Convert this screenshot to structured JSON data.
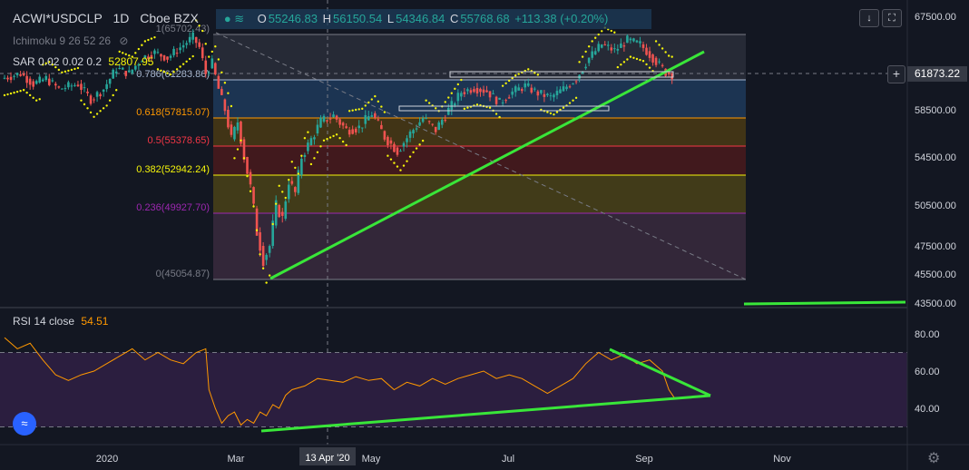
{
  "header": {
    "symbol": "ACWI*USDCLP",
    "interval": "1D",
    "exchange": "Cboe BZX",
    "open_label": "O",
    "open": "55246.83",
    "high_label": "H",
    "high": "56150.54",
    "low_label": "L",
    "low": "54346.84",
    "close_label": "C",
    "close": "55768.68",
    "change": "+113.38 (+0.20%)"
  },
  "indicators": {
    "ichimoku": "Ichimoku 9 26 52 26",
    "sar_label": "SAR 0.02 0.02 0.2",
    "sar_value": "52807.95",
    "rsi_label": "RSI 14 close",
    "rsi_value": "54.51"
  },
  "current_price": "61873.22",
  "colors": {
    "background": "#131722",
    "up": "#26a69a",
    "down": "#ef5350",
    "trendline": "#39e639",
    "sar": "#f5f50a",
    "rsi": "#ff9800",
    "rsi_band": "#2b1e3f"
  },
  "icons": [
    "eye-off-icon",
    "arrow-down-icon",
    "fullscreen-icon",
    "plus-icon",
    "gear-icon",
    "tradingview-logo-icon"
  ],
  "chart_data": {
    "type": "candlestick",
    "price_axis": {
      "ticks": [
        "67500.00",
        "58500.00",
        "54500.00",
        "50500.00",
        "47500.00",
        "45500.00",
        "43500.00"
      ],
      "tick_values": [
        67500,
        58500,
        54500,
        50500,
        47500,
        45500,
        43500
      ],
      "range": [
        43500,
        67500
      ]
    },
    "time_axis": {
      "ticks": [
        "2020",
        "Mar",
        "May",
        "Jul",
        "Sep",
        "Nov"
      ],
      "crosshair_label": "13 Apr '20"
    },
    "fib_levels": [
      {
        "label": "1(65702.43)",
        "ratio": 1,
        "value": 65702.43,
        "color": "#787b86"
      },
      {
        "label": "0.786(61283.86)",
        "ratio": 0.786,
        "value": 61283.86,
        "color": "#a6b7d1"
      },
      {
        "label": "0.618(57815.07)",
        "ratio": 0.618,
        "value": 57815.07,
        "color": "#ff9800"
      },
      {
        "label": "0.5(55378.65)",
        "ratio": 0.5,
        "value": 55378.65,
        "color": "#f23645"
      },
      {
        "label": "0.382(52942.24)",
        "ratio": 0.382,
        "value": 52942.24,
        "color": "#f5f50a"
      },
      {
        "label": "0.236(49927.70)",
        "ratio": 0.236,
        "value": 49927.7,
        "color": "#9c27b0"
      },
      {
        "label": "0(45054.87)",
        "ratio": 0,
        "value": 45054.87,
        "color": "#787b86"
      }
    ],
    "rsi_axis": {
      "ticks": [
        "80.00",
        "60.00",
        "40.00"
      ],
      "tick_values": [
        80,
        60,
        40
      ],
      "range": [
        25,
        90
      ],
      "upper_band": 70,
      "lower_band": 30
    },
    "price_path": [
      [
        0,
        61500
      ],
      [
        6,
        62000
      ],
      [
        10,
        61000
      ],
      [
        14,
        61500
      ],
      [
        18,
        60500
      ],
      [
        24,
        61000
      ],
      [
        28,
        59500
      ],
      [
        32,
        60500
      ],
      [
        36,
        62500
      ],
      [
        40,
        62000
      ],
      [
        44,
        63500
      ],
      [
        48,
        64000
      ],
      [
        52,
        63500
      ],
      [
        56,
        64500
      ],
      [
        60,
        65500
      ],
      [
        62,
        64500
      ],
      [
        64,
        62000
      ],
      [
        66,
        63000
      ],
      [
        68,
        60500
      ],
      [
        70,
        58500
      ],
      [
        72,
        56000
      ],
      [
        74,
        57500
      ],
      [
        76,
        54500
      ],
      [
        78,
        52000
      ],
      [
        80,
        48500
      ],
      [
        82,
        46500
      ],
      [
        84,
        47500
      ],
      [
        86,
        50500
      ],
      [
        88,
        49500
      ],
      [
        90,
        52500
      ],
      [
        92,
        51500
      ],
      [
        94,
        54500
      ],
      [
        96,
        55500
      ],
      [
        98,
        56500
      ],
      [
        100,
        57500
      ],
      [
        104,
        58000
      ],
      [
        108,
        56800
      ],
      [
        112,
        57000
      ],
      [
        116,
        58200
      ],
      [
        120,
        56200
      ],
      [
        124,
        55000
      ],
      [
        128,
        56500
      ],
      [
        132,
        57800
      ],
      [
        136,
        56800
      ],
      [
        140,
        58500
      ],
      [
        144,
        60200
      ],
      [
        148,
        60600
      ],
      [
        152,
        60300
      ],
      [
        156,
        59200
      ],
      [
        160,
        60200
      ],
      [
        164,
        60800
      ],
      [
        168,
        60100
      ],
      [
        172,
        59700
      ],
      [
        176,
        60500
      ],
      [
        180,
        61500
      ],
      [
        184,
        63500
      ],
      [
        188,
        64800
      ],
      [
        192,
        64200
      ],
      [
        196,
        65200
      ],
      [
        200,
        64800
      ],
      [
        204,
        63500
      ],
      [
        208,
        62100
      ],
      [
        210,
        61900
      ]
    ],
    "rsi_path": [
      [
        0,
        78
      ],
      [
        4,
        72
      ],
      [
        8,
        75
      ],
      [
        12,
        66
      ],
      [
        16,
        58
      ],
      [
        20,
        55
      ],
      [
        24,
        58
      ],
      [
        28,
        60
      ],
      [
        32,
        64
      ],
      [
        36,
        68
      ],
      [
        40,
        72
      ],
      [
        44,
        66
      ],
      [
        48,
        70
      ],
      [
        52,
        66
      ],
      [
        56,
        64
      ],
      [
        60,
        70
      ],
      [
        63,
        72
      ],
      [
        64,
        50
      ],
      [
        66,
        40
      ],
      [
        68,
        32
      ],
      [
        70,
        36
      ],
      [
        72,
        38
      ],
      [
        74,
        31
      ],
      [
        76,
        34
      ],
      [
        78,
        32
      ],
      [
        80,
        38
      ],
      [
        82,
        36
      ],
      [
        84,
        42
      ],
      [
        86,
        40
      ],
      [
        88,
        47
      ],
      [
        90,
        50
      ],
      [
        94,
        52
      ],
      [
        98,
        56
      ],
      [
        102,
        55
      ],
      [
        106,
        54
      ],
      [
        110,
        57
      ],
      [
        114,
        55
      ],
      [
        118,
        56
      ],
      [
        122,
        50
      ],
      [
        126,
        54
      ],
      [
        130,
        52
      ],
      [
        134,
        56
      ],
      [
        138,
        53
      ],
      [
        142,
        56
      ],
      [
        146,
        58
      ],
      [
        150,
        60
      ],
      [
        154,
        56
      ],
      [
        158,
        58
      ],
      [
        162,
        56
      ],
      [
        166,
        52
      ],
      [
        170,
        48
      ],
      [
        174,
        52
      ],
      [
        178,
        56
      ],
      [
        182,
        64
      ],
      [
        186,
        70
      ],
      [
        190,
        66
      ],
      [
        194,
        69
      ],
      [
        198,
        64
      ],
      [
        202,
        66
      ],
      [
        206,
        60
      ],
      [
        208,
        50
      ],
      [
        210,
        45
      ]
    ]
  }
}
